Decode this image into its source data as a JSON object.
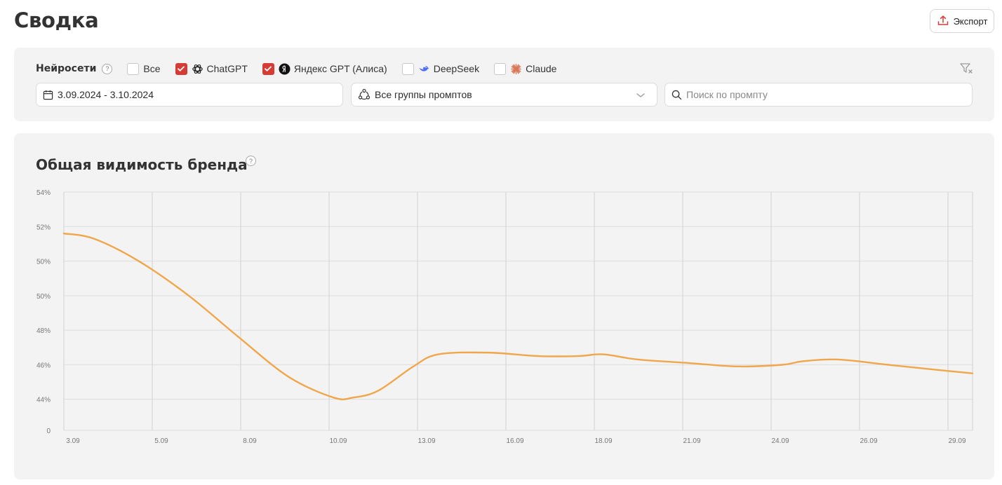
{
  "page": {
    "title": "Сводка"
  },
  "toolbar": {
    "export_label": "Экспорт"
  },
  "filters": {
    "label": "Нейросети",
    "help": "?",
    "networks": [
      {
        "label": "Все",
        "checked": false,
        "icon": "none"
      },
      {
        "label": "ChatGPT",
        "checked": true,
        "icon": "chatgpt-icon"
      },
      {
        "label": "Яндекс GPT (Алиса)",
        "checked": true,
        "icon": "yandex-icon"
      },
      {
        "label": "DeepSeek",
        "checked": false,
        "icon": "deepseek-icon"
      },
      {
        "label": "Claude",
        "checked": false,
        "icon": "claude-icon"
      }
    ],
    "date_range": "3.09.2024 - 3.10.2024",
    "prompt_group": "Все группы промптов",
    "search_placeholder": "Поиск по промпту"
  },
  "chart": {
    "title": "Общая видимость бренда",
    "help": "?"
  },
  "chart_data": {
    "type": "line",
    "title": "Общая видимость бренда",
    "color": "#f0a64a",
    "x_ticks": [
      "3.09",
      "5.09",
      "8.09",
      "10.09",
      "13.09",
      "16.09",
      "18.09",
      "21.09",
      "24.09",
      "26.09",
      "29.09"
    ],
    "y_ticks": [
      "0",
      "44%",
      "46%",
      "48%",
      "50%",
      "50%",
      "52%",
      "54%"
    ],
    "y_tick_values": [
      42.2,
      44,
      46,
      48,
      50,
      52,
      54,
      56
    ],
    "ylim": [
      42.2,
      56
    ],
    "grid": true,
    "series": [
      {
        "points": [
          [
            0.0,
            53.6
          ],
          [
            0.6,
            53.3
          ],
          [
            1.5,
            52.0
          ],
          [
            2.5,
            50.0
          ],
          [
            3.5,
            47.6
          ],
          [
            4.5,
            45.3
          ],
          [
            5.4,
            44.1
          ],
          [
            5.8,
            44.1
          ],
          [
            6.3,
            44.5
          ],
          [
            7.0,
            45.9
          ],
          [
            7.5,
            46.6
          ],
          [
            8.5,
            46.7
          ],
          [
            9.5,
            46.5
          ],
          [
            10.3,
            46.5
          ],
          [
            10.8,
            46.6
          ],
          [
            11.5,
            46.3
          ],
          [
            12.5,
            46.1
          ],
          [
            13.5,
            45.9
          ],
          [
            14.4,
            46.0
          ],
          [
            14.8,
            46.2
          ],
          [
            15.5,
            46.3
          ],
          [
            16.5,
            46.0
          ],
          [
            17.5,
            45.7
          ],
          [
            18.2,
            45.5
          ]
        ]
      }
    ]
  }
}
